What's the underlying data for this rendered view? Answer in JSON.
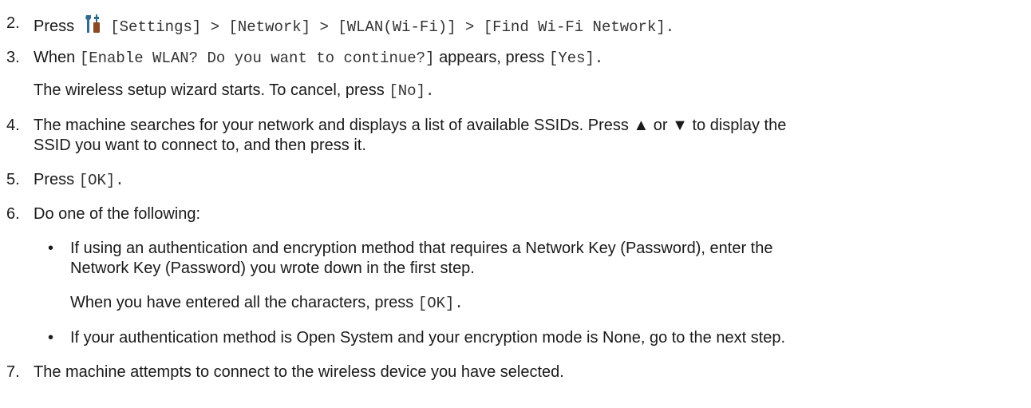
{
  "steps": {
    "s2": {
      "num": "2.",
      "press": "Press",
      "path": "[Settings] > [Network] > [WLAN(Wi-Fi)] > [Find Wi-Fi Network].",
      "icon": "settings-icon"
    },
    "s3": {
      "num": "3.",
      "when": "When",
      "prompt": "[Enable WLAN? Do you want to continue?]",
      "appears": "appears, press",
      "yes": "[Yes].",
      "note_text": "The wireless setup wizard starts. To cancel, press",
      "no": "[No]."
    },
    "s4": {
      "num": "4.",
      "line1": "The machine searches for your network and displays a list of available SSIDs. Press ▲ or ▼ to display the",
      "line2": "SSID you want to connect to, and then press it."
    },
    "s5": {
      "num": "5.",
      "press": "Press",
      "ok": "[OK]."
    },
    "s6": {
      "num": "6.",
      "text": "Do one of the following:",
      "bullet1_line1": "If using an authentication and encryption method that requires a Network Key (Password), enter the",
      "bullet1_line2": "Network Key (Password) you wrote down in the first step.",
      "bullet1_note": "When you have entered all the characters, press",
      "ok": "[OK].",
      "bullet2": "If your authentication method is Open System and your encryption mode is None, go to the next step.",
      "bullet_char": "•"
    },
    "s7": {
      "num": "7.",
      "text": "The machine attempts to connect to the wireless device you have selected."
    }
  },
  "colors": {
    "icon_dark": "#2d6e8e",
    "icon_brown": "#8a4a24",
    "text": "#1a1a1a"
  }
}
